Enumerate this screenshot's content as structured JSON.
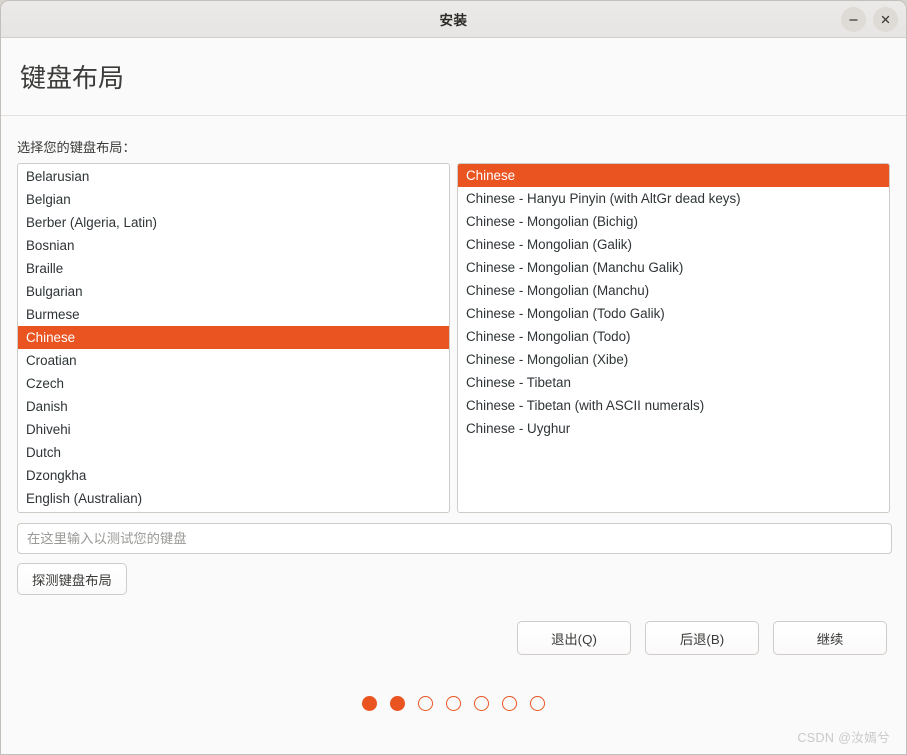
{
  "window": {
    "title": "安装",
    "buttons": {
      "minimize": "minimize",
      "close": "close"
    }
  },
  "page": {
    "title": "键盘布局",
    "choose_label": "选择您的键盘布局："
  },
  "layout_list": {
    "selected": "Chinese",
    "items": [
      "Belarusian",
      "Belgian",
      "Berber (Algeria, Latin)",
      "Bosnian",
      "Braille",
      "Bulgarian",
      "Burmese",
      "Chinese",
      "Croatian",
      "Czech",
      "Danish",
      "Dhivehi",
      "Dutch",
      "Dzongkha",
      "English (Australian)"
    ]
  },
  "variant_list": {
    "selected": "Chinese",
    "items": [
      "Chinese",
      "Chinese - Hanyu Pinyin (with AltGr dead keys)",
      "Chinese - Mongolian (Bichig)",
      "Chinese - Mongolian (Galik)",
      "Chinese - Mongolian (Manchu Galik)",
      "Chinese - Mongolian (Manchu)",
      "Chinese - Mongolian (Todo Galik)",
      "Chinese - Mongolian (Todo)",
      "Chinese - Mongolian (Xibe)",
      "Chinese - Tibetan",
      "Chinese - Tibetan (with ASCII numerals)",
      "Chinese - Uyghur"
    ]
  },
  "test_entry": {
    "value": "",
    "placeholder": "在这里输入以测试您的键盘"
  },
  "detect_button": {
    "label": "探测键盘布局"
  },
  "actions": {
    "quit": "退出(Q)",
    "back": "后退(B)",
    "continue": "继续"
  },
  "progress": {
    "total": 7,
    "completed": 2,
    "accent": "#e95420"
  },
  "watermark": "CSDN @汝嫣兮"
}
